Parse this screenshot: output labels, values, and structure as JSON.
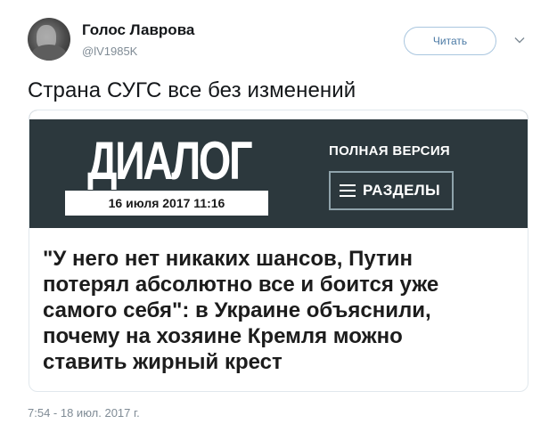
{
  "user": {
    "display_name": "Голос Лаврова",
    "handle": "@lV1985K"
  },
  "follow_button": {
    "label": "Читать"
  },
  "tweet": {
    "text": "Страна СУГС все без изменений",
    "timestamp": "7:54 - 18 июл. 2017 г."
  },
  "card": {
    "logo": "ДИАЛОГ",
    "date": "16 июля 2017 11:16",
    "full_version": "ПОЛНАЯ ВЕРСИЯ",
    "sections_label": "РАЗДЕЛЫ",
    "headline_lines": [
      "\"У него нет никаких шансов, Путин",
      "потерял абсолютно все и боится уже",
      "самого себя\": в Украине объяснили,",
      "почему на хозяине Кремля можно",
      "ставить жирный крест"
    ]
  },
  "colors": {
    "header_bg": "#2c383d",
    "accent": "#4b7aa5"
  }
}
